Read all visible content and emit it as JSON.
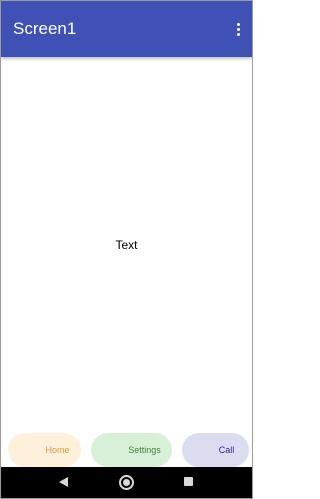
{
  "app_bar": {
    "title": "Screen1",
    "menu_icon": "more-vert-icon",
    "color": "#3f51b5"
  },
  "content": {
    "label": "Text"
  },
  "buttons": {
    "home": {
      "label": "Home",
      "color": "#fff0dc",
      "text_color": "#d79a3a"
    },
    "settings": {
      "label": "Settings",
      "color": "#d7f0d7",
      "text_color": "#3a8a3a"
    },
    "call": {
      "label": "Call",
      "color": "#dcdcf0",
      "text_color": "#2a2a8a"
    }
  },
  "system_nav": {
    "back_icon": "back-triangle-icon",
    "home_icon": "home-circle-icon",
    "recents_icon": "recents-square-icon"
  }
}
